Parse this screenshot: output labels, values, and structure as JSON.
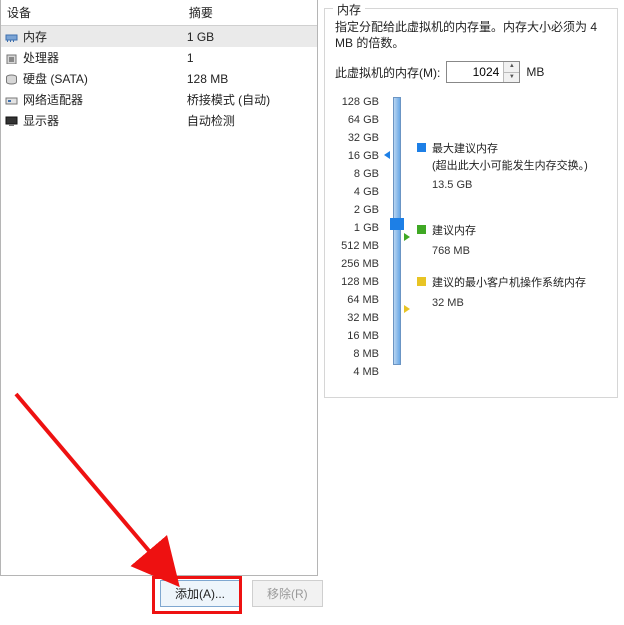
{
  "left": {
    "headers": {
      "device": "设备",
      "summary": "摘要"
    },
    "rows": [
      {
        "icon": "memory",
        "name": "内存",
        "summary": "1 GB",
        "selected": true
      },
      {
        "icon": "cpu",
        "name": "处理器",
        "summary": "1"
      },
      {
        "icon": "disk",
        "name": "硬盘 (SATA)",
        "summary": "128 MB"
      },
      {
        "icon": "nic",
        "name": "网络适配器",
        "summary": "桥接模式 (自动)"
      },
      {
        "icon": "display",
        "name": "显示器",
        "summary": "自动检测"
      }
    ],
    "buttons": {
      "add": "添加(A)...",
      "remove": "移除(R)"
    }
  },
  "mem": {
    "group_title": "内存",
    "desc": "指定分配给此虚拟机的内存量。内存大小必须为 4 MB 的倍数。",
    "label": "此虚拟机的内存(M):",
    "value": "1024",
    "unit": "MB",
    "ticks": [
      "128 GB",
      "64 GB",
      "32 GB",
      "16 GB",
      "8 GB",
      "4 GB",
      "2 GB",
      "1 GB",
      "512 MB",
      "256 MB",
      "128 MB",
      "64 MB",
      "32 MB",
      "16 MB",
      "8 MB",
      "4 MB"
    ],
    "legend": {
      "max": {
        "title": "最大建议内存",
        "note": "(超出此大小可能发生内存交换。)",
        "value": "13.5 GB"
      },
      "rec": {
        "title": "建议内存",
        "value": "768 MB"
      },
      "min": {
        "title": "建议的最小客户机操作系统内存",
        "value": "32 MB"
      }
    }
  }
}
